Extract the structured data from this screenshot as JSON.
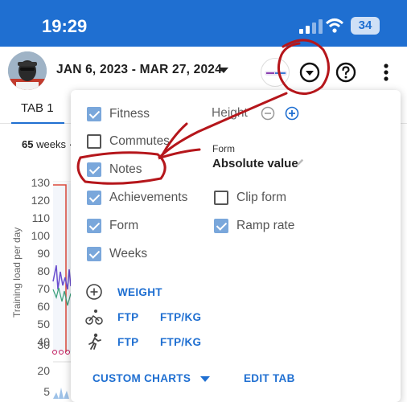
{
  "status_bar": {
    "time": "19:29",
    "battery": "34"
  },
  "header": {
    "date_range": "JAN 6, 2023 - MAR 27, 2024"
  },
  "tabs": [
    {
      "label": "TAB 1"
    }
  ],
  "summary": {
    "weeks_count": "65",
    "weeks_suffix": "weeks ·"
  },
  "chart": {
    "ylabel": "Training load per day",
    "ticks_top": [
      "130",
      "120",
      "110",
      "100",
      "90",
      "80",
      "70",
      "60",
      "50",
      "40",
      "30"
    ],
    "ticks_bottom": [
      "20",
      "5"
    ]
  },
  "menu": {
    "checkboxes_left": [
      {
        "label": "Fitness",
        "checked": true
      },
      {
        "label": "Commutes",
        "checked": false
      },
      {
        "label": "Notes",
        "checked": true
      },
      {
        "label": "Achievements",
        "checked": true
      },
      {
        "label": "Form",
        "checked": true
      },
      {
        "label": "Weeks",
        "checked": true
      }
    ],
    "height_label": "Height",
    "form_heading": "Form",
    "form_value": "Absolute value",
    "checkboxes_right": [
      {
        "label": "Clip form",
        "checked": false
      },
      {
        "label": "Ramp rate",
        "checked": true
      }
    ],
    "weight_link": "WEIGHT",
    "ride_ftp": "FTP",
    "ride_ftp_kg": "FTP/KG",
    "run_ftp": "FTP",
    "run_ftp_kg": "FTP/KG",
    "custom_charts": "CUSTOM CHARTS",
    "edit_tab": "EDIT TAB"
  },
  "colors": {
    "accent": "#1f6fd1",
    "checkbox": "#7aa7db",
    "annotation": "#b5161b"
  }
}
